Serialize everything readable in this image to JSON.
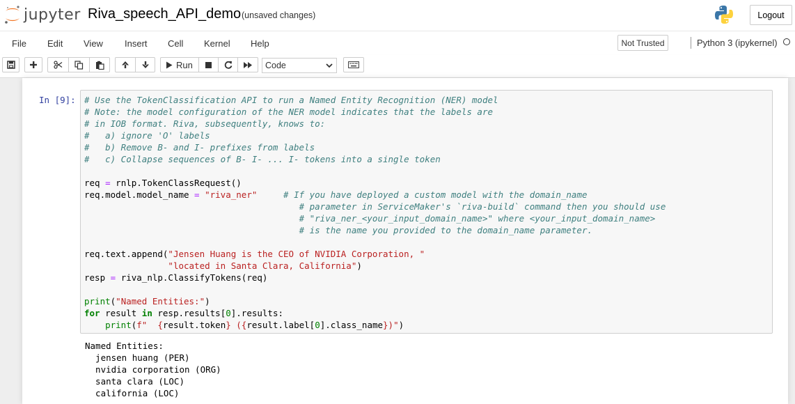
{
  "header": {
    "logo_text": "jupyter",
    "notebook_title": "Riva_speech_API_demo",
    "save_status": "(unsaved changes)",
    "logout_label": "Logout"
  },
  "menubar": {
    "items": [
      "File",
      "Edit",
      "View",
      "Insert",
      "Cell",
      "Kernel",
      "Help"
    ],
    "trust_label": "Not Trusted",
    "kernel_name": "Python 3 (ipykernel)"
  },
  "toolbar": {
    "run_label": "Run",
    "cell_type": "Code",
    "icons": [
      "save-icon",
      "plus-icon",
      "cut-icon",
      "copy-icon",
      "paste-icon",
      "arrow-up-icon",
      "arrow-down-icon",
      "play-icon",
      "stop-icon",
      "restart-icon",
      "fast-forward-icon",
      "keyboard-icon"
    ]
  },
  "cell": {
    "prompt": "In [9]:",
    "code_lines": [
      [
        [
          "cm",
          "# Use the TokenClassification API to run a Named Entity Recognition (NER) model"
        ]
      ],
      [
        [
          "cm",
          "# Note: the model configuration of the NER model indicates that the labels are"
        ]
      ],
      [
        [
          "cm",
          "# in IOB format. Riva, subsequently, knows to:"
        ]
      ],
      [
        [
          "cm",
          "#   a) ignore 'O' labels"
        ]
      ],
      [
        [
          "cm",
          "#   b) Remove B- and I- prefixes from labels"
        ]
      ],
      [
        [
          "cm",
          "#   c) Collapse sequences of B- I- ... I- tokens into a single token"
        ]
      ],
      [],
      [
        [
          "",
          "req "
        ],
        [
          "op",
          "="
        ],
        [
          "",
          " rnlp.TokenClassRequest()"
        ]
      ],
      [
        [
          "",
          "req.model.model_name "
        ],
        [
          "op",
          "="
        ],
        [
          "",
          " "
        ],
        [
          "st",
          "\"riva_ner\""
        ],
        [
          "",
          "     "
        ],
        [
          "cm",
          "# If you have deployed a custom model with the domain_name"
        ]
      ],
      [
        [
          "",
          "                                         "
        ],
        [
          "cm",
          "# parameter in ServiceMaker's `riva-build` command then you should use"
        ]
      ],
      [
        [
          "",
          "                                         "
        ],
        [
          "cm",
          "# \"riva_ner_<your_input_domain_name>\" where <your_input_domain_name>"
        ]
      ],
      [
        [
          "",
          "                                         "
        ],
        [
          "cm",
          "# is the name you provided to the domain_name parameter."
        ]
      ],
      [],
      [
        [
          "",
          "req.text.append("
        ],
        [
          "st",
          "\"Jensen Huang is the CEO of NVIDIA Corporation, \""
        ]
      ],
      [
        [
          "",
          "                "
        ],
        [
          "st",
          "\"located in Santa Clara, California\""
        ],
        [
          "",
          ")"
        ]
      ],
      [
        [
          "",
          "resp "
        ],
        [
          "op",
          "="
        ],
        [
          "",
          " riva_nlp.ClassifyTokens(req)"
        ]
      ],
      [],
      [
        [
          "nu",
          "print"
        ],
        [
          "",
          "("
        ],
        [
          "st",
          "\"Named Entities:\""
        ],
        [
          "",
          ")"
        ]
      ],
      [
        [
          "kw",
          "for"
        ],
        [
          "",
          " result "
        ],
        [
          "kw",
          "in"
        ],
        [
          "",
          " resp.results["
        ],
        [
          "nu",
          "0"
        ],
        [
          "",
          "].results:"
        ]
      ],
      [
        [
          "",
          "    "
        ],
        [
          "nu",
          "print"
        ],
        [
          "",
          "("
        ],
        [
          "st",
          "f\"  {"
        ],
        [
          "",
          "result.token"
        ],
        [
          "st",
          "} ({"
        ],
        [
          "",
          "result.label["
        ],
        [
          "nu",
          "0"
        ],
        [
          "",
          "].class_name"
        ],
        [
          "st",
          "})\""
        ],
        [
          "",
          ")"
        ]
      ]
    ],
    "output_lines": [
      "Named Entities:",
      "  jensen huang (PER)",
      "  nvidia corporation (ORG)",
      "  santa clara (LOC)",
      "  california (LOC)"
    ]
  }
}
